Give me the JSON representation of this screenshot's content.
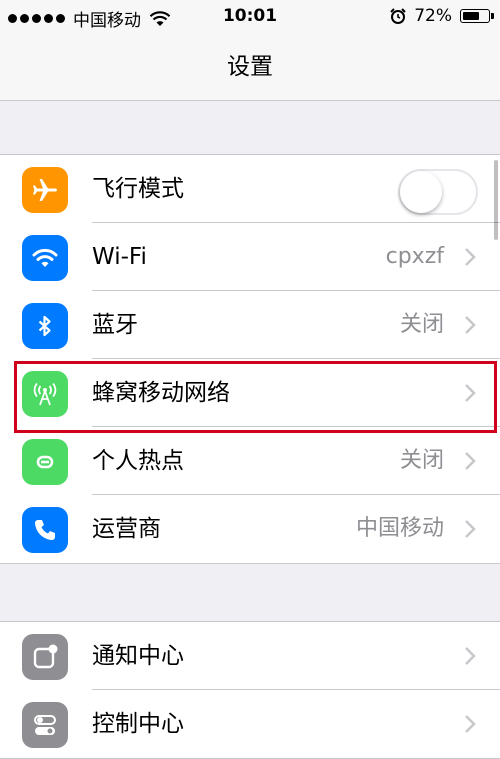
{
  "status_bar": {
    "carrier": "中国移动",
    "time": "10:01",
    "battery_percent": "72%",
    "battery_level": 0.72,
    "icons": [
      "signal-dots-icon",
      "wifi-icon",
      "alarm-icon",
      "battery-icon"
    ]
  },
  "nav": {
    "title": "设置"
  },
  "groups": [
    {
      "rows": [
        {
          "label": "飞行模式",
          "icon": "airplane-icon",
          "icon_color": "#ff9500",
          "control": "toggle",
          "toggle_on": false
        },
        {
          "label": "Wi-Fi",
          "value": "cpxzf",
          "icon": "wifi-icon",
          "icon_color": "#007aff"
        },
        {
          "label": "蓝牙",
          "value": "关闭",
          "icon": "bluetooth-icon",
          "icon_color": "#007aff"
        },
        {
          "label": "蜂窝移动网络",
          "value": "",
          "icon": "cellular-antenna-icon",
          "icon_color": "#4cd964",
          "highlighted": true
        },
        {
          "label": "个人热点",
          "value": "关闭",
          "icon": "hotspot-icon",
          "icon_color": "#4cd964"
        },
        {
          "label": "运营商",
          "value": "中国移动",
          "icon": "phone-icon",
          "icon_color": "#007aff"
        }
      ]
    },
    {
      "rows": [
        {
          "label": "通知中心",
          "icon": "notification-center-icon",
          "icon_color": "#8e8e93"
        },
        {
          "label": "控制中心",
          "icon": "control-center-icon",
          "icon_color": "#8e8e93"
        }
      ]
    }
  ],
  "colors": {
    "highlight_border": "#d0021b",
    "separator": "#c8c7cc",
    "background": "#efeff4"
  }
}
